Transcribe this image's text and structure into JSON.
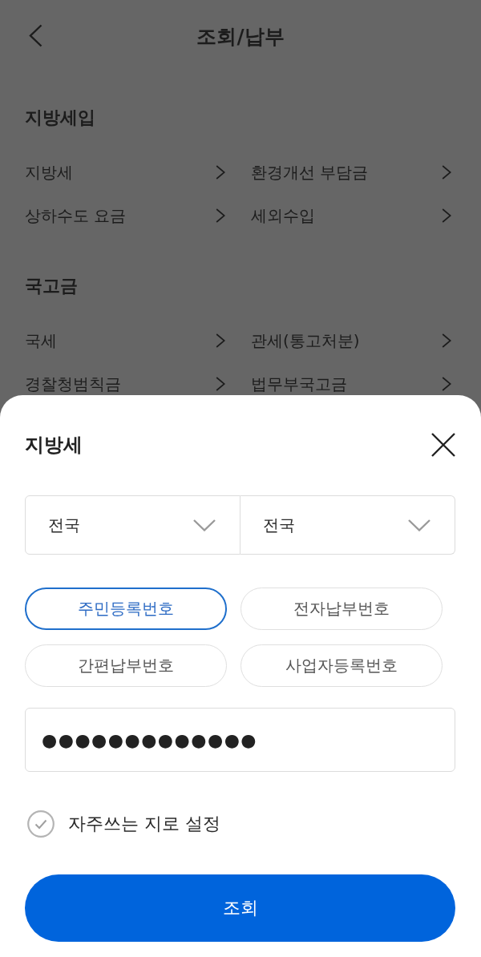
{
  "background_page": {
    "dimmed": true,
    "header": {
      "title": "조회/납부"
    },
    "sections": [
      {
        "title": "지방세입",
        "items": [
          {
            "label": "지방세"
          },
          {
            "label": "환경개선 부담금"
          },
          {
            "label": "상하수도 요금"
          },
          {
            "label": "세외수입"
          }
        ]
      },
      {
        "title": "국고금",
        "items": [
          {
            "label": "국세"
          },
          {
            "label": "관세(통고처분)"
          },
          {
            "label": "경찰청범칙금"
          },
          {
            "label": "법무부국고금"
          }
        ]
      }
    ]
  },
  "sheet": {
    "title": "지방세",
    "dropdowns": [
      {
        "value": "전국"
      },
      {
        "value": "전국"
      }
    ],
    "id_types": [
      {
        "label": "주민등록번호",
        "selected": true
      },
      {
        "label": "전자납부번호",
        "selected": false
      },
      {
        "label": "간편납부번호",
        "selected": false
      },
      {
        "label": "사업자등록번호",
        "selected": false
      }
    ],
    "number_field": {
      "value": "●●●●●●●●●●●●●"
    },
    "favorite_option": {
      "label": "자주쓰는 지로 설정",
      "checked": false
    },
    "submit_button": {
      "label": "조회"
    }
  }
}
